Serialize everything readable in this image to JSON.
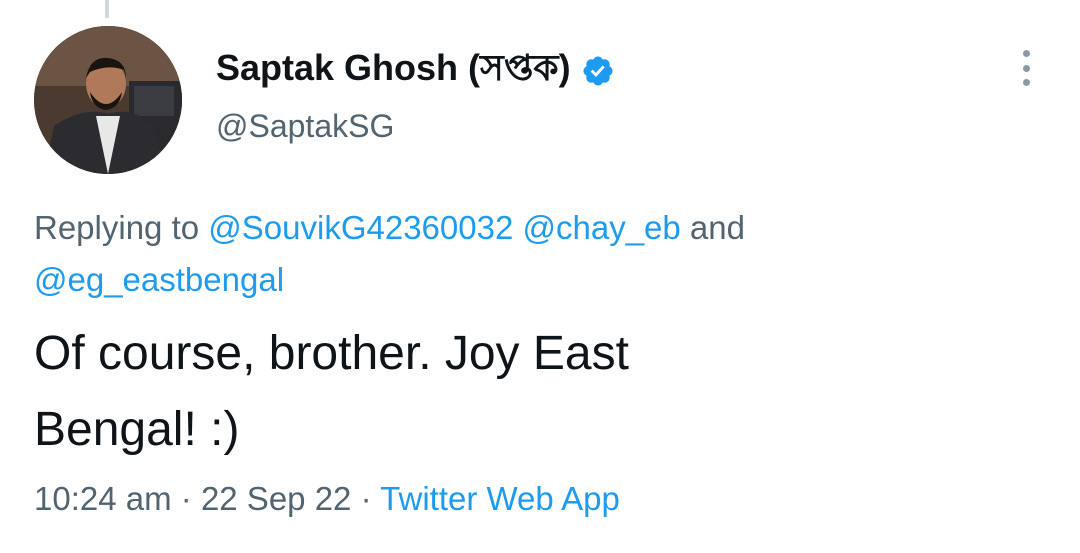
{
  "tweet": {
    "author": {
      "display_name": "Saptak Ghosh (সপ্তক)",
      "handle": "@SaptakSG",
      "verified": true,
      "verified_icon": "verified-badge-icon",
      "avatar": "profile-photo"
    },
    "reply": {
      "prefix": "Replying to ",
      "mentions": [
        "@SouvikG42360032",
        "@chay_eb",
        "@eg_eastbengal"
      ],
      "connector": "and"
    },
    "text_line1": "Of course, brother. Joy East",
    "text_line2": "Bengal! :)",
    "time": "10:24 am",
    "separator": "·",
    "date": "22 Sep 22",
    "source": "Twitter Web App",
    "more_icon": "more-options-icon"
  },
  "colors": {
    "link": "#1d9bf0",
    "secondary_text": "#536471",
    "primary_text": "#0f1419",
    "background": "#ffffff"
  }
}
